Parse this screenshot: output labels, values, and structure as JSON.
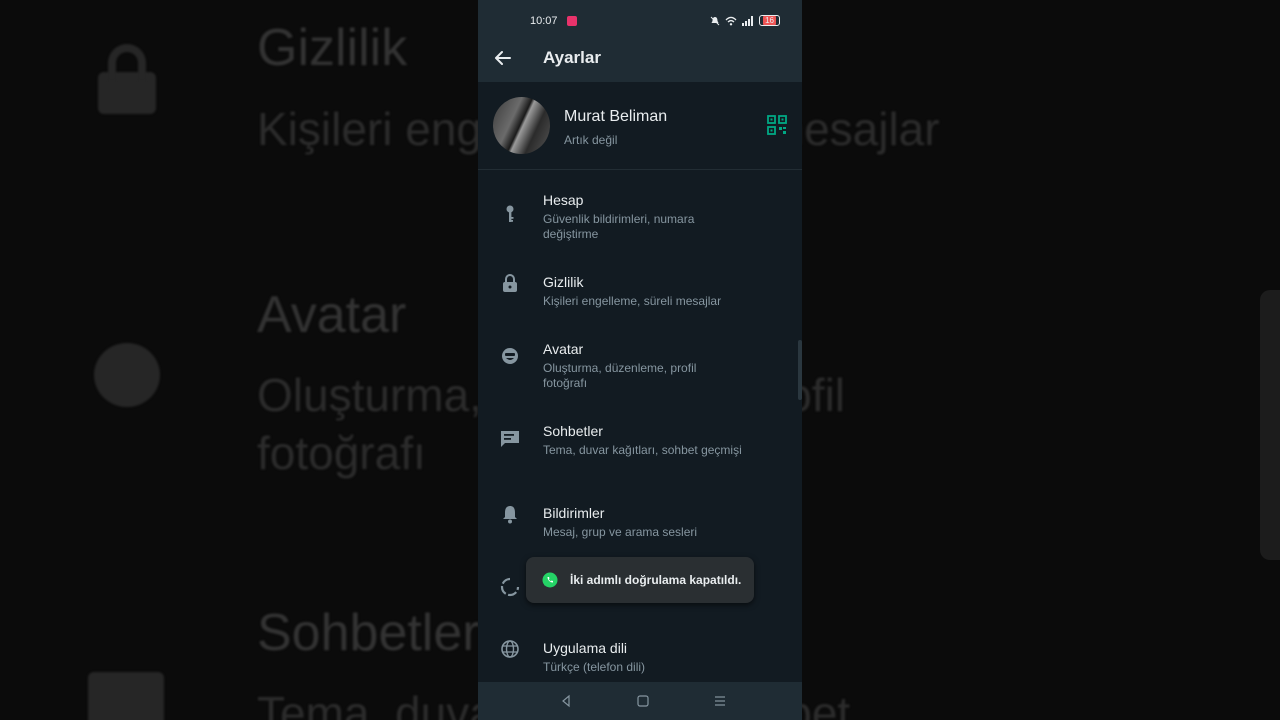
{
  "background": {
    "title_top": "Gizlilik",
    "line_top": "Kişileri engelleme, süreli mesajlar",
    "title_mid": "Avatar",
    "line_mid_1": "Oluşturma, düzenleme, profil",
    "line_mid_2": "fotoğrafı",
    "title_bottom": "Sohbetler",
    "line_bottom": "Tema, duvar kağıtları, sohbet"
  },
  "status_bar": {
    "time": "10:07",
    "battery": "16"
  },
  "app_bar": {
    "title": "Ayarlar",
    "back_icon": "arrow-left-icon"
  },
  "profile": {
    "name": "Murat Beliman",
    "status": "Artık değil",
    "qr_icon": "qr-code-icon"
  },
  "settings": [
    {
      "icon": "key-icon",
      "label": "Hesap",
      "sub": "Güvenlik bildirimleri, numara değiştirme"
    },
    {
      "icon": "lock-icon",
      "label": "Gizlilik",
      "sub": "Kişileri engelleme, süreli mesajlar"
    },
    {
      "icon": "avatar-icon",
      "label": "Avatar",
      "sub": "Oluşturma, düzenleme, profil fotoğrafı"
    },
    {
      "icon": "chat-icon",
      "label": "Sohbetler",
      "sub": "Tema, duvar kağıtları, sohbet geçmişi"
    },
    {
      "icon": "bell-icon",
      "label": "Bildirimler",
      "sub": "Mesaj, grup ve arama sesleri"
    },
    {
      "icon": "data-usage-icon",
      "label": "",
      "sub": ""
    },
    {
      "icon": "globe-icon",
      "label": "Uygulama dili",
      "sub": "Türkçe (telefon dili)"
    }
  ],
  "toast": {
    "message": "İki adımlı doğrulama kapatıldı.",
    "icon": "whatsapp-icon"
  },
  "colors": {
    "background": "#121b22",
    "bar": "#1f2c34",
    "accent": "#00a884",
    "text_primary": "#e9edef",
    "text_secondary": "#8696a0"
  }
}
